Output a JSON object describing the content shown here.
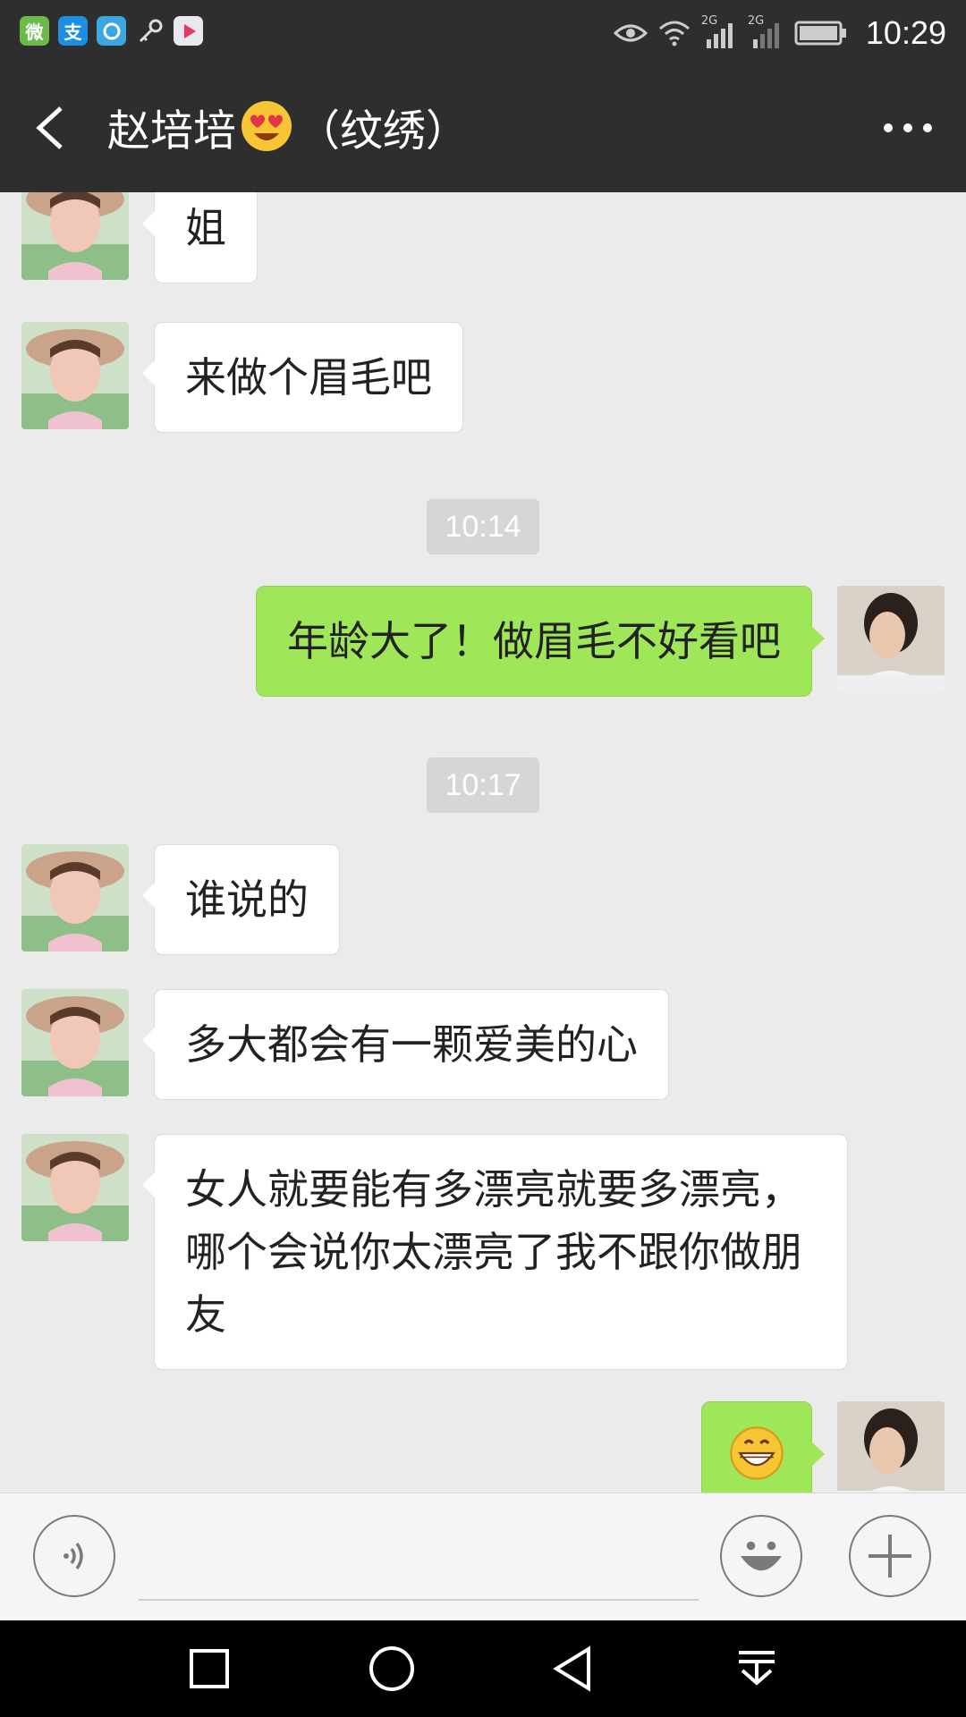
{
  "status_bar": {
    "time": "10:29",
    "app_icons": [
      "weixin-helper-icon",
      "alipay-icon",
      "browser-icon",
      "key-icon",
      "video-app-icon"
    ],
    "icons": [
      "eye-icon",
      "wifi-icon",
      "signal-2g-icon",
      "signal-2g-icon",
      "battery-icon"
    ],
    "signal_label_1": "2G",
    "signal_label_2": "2G"
  },
  "header": {
    "title_name": "赵培培",
    "title_suffix": "（纹绣）",
    "back_icon": "chevron-left-icon",
    "more_icon": "more-dots-icon"
  },
  "messages": [
    {
      "side": "in",
      "text": "姐"
    },
    {
      "side": "in",
      "text": "来做个眉毛吧"
    },
    {
      "type": "time",
      "text": "10:14"
    },
    {
      "side": "out",
      "text": "年龄大了！做眉毛不好看吧"
    },
    {
      "type": "time",
      "text": "10:17"
    },
    {
      "side": "in",
      "text": "谁说的"
    },
    {
      "side": "in",
      "text": "多大都会有一颗爱美的心"
    },
    {
      "side": "in",
      "line1": "女人就要能有多漂亮就要多漂亮，",
      "line2": "哪个会说你太漂亮了我不跟你做朋",
      "line3": "友"
    },
    {
      "side": "out",
      "emoji": "grin-emoji"
    }
  ],
  "input_bar": {
    "voice_icon": "voice-icon",
    "emoji_icon": "smiley-icon",
    "plus_icon": "plus-icon"
  },
  "nav_bar": {
    "icons": [
      "square-recent-icon",
      "circle-home-icon",
      "triangle-back-icon",
      "notification-pulldown-icon"
    ]
  },
  "colors": {
    "titlebar": "#2e2e2e",
    "chat_bg": "#ebebeb",
    "bubble_out": "#9fe658",
    "bubble_in": "#ffffff"
  }
}
